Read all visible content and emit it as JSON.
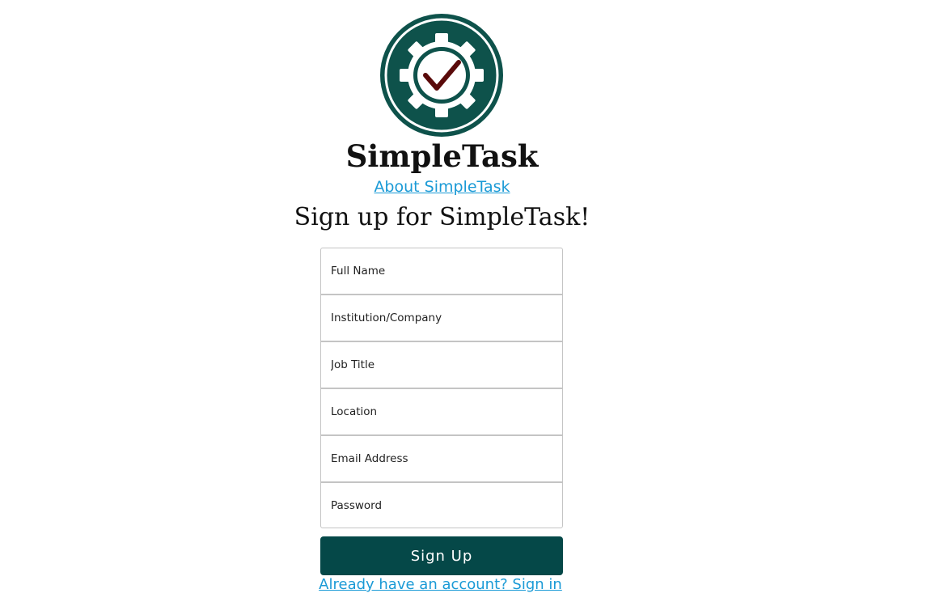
{
  "app": {
    "name": "SimpleTask",
    "logo_icon": "gear-checkmark-icon",
    "about_link": "About SimpleTask"
  },
  "signup": {
    "heading": "Sign up for SimpleTask!",
    "fields": {
      "full_name": {
        "placeholder": "Full Name",
        "value": ""
      },
      "institution": {
        "placeholder": "Institution/Company",
        "value": ""
      },
      "job_title": {
        "placeholder": "Job Title",
        "value": ""
      },
      "location": {
        "placeholder": "Location",
        "value": ""
      },
      "email": {
        "placeholder": "Email Address",
        "value": ""
      },
      "password": {
        "placeholder": "Password",
        "value": ""
      }
    },
    "submit_label": "Sign Up",
    "signin_link": "Already have an account? Sign in"
  },
  "colors": {
    "brand_teal": "#054848",
    "logo_circle": "#0e524b",
    "checkmark": "#5a0a0a",
    "link": "#1a9ad6"
  }
}
